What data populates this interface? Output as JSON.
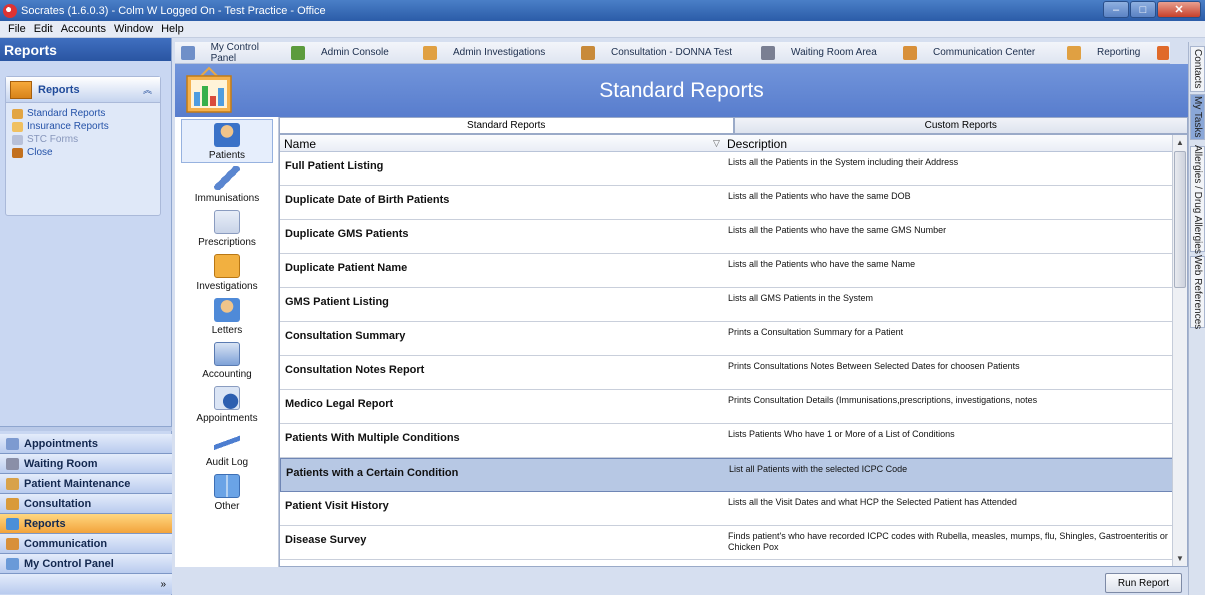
{
  "window": {
    "title": "Socrates (1.6.0.3) - Colm W Logged On - Test Practice - Office"
  },
  "menu": [
    "File",
    "Edit",
    "Accounts",
    "Window",
    "Help"
  ],
  "left_nav": {
    "title": "Reports",
    "task_panel": {
      "title": "Reports",
      "items": [
        {
          "label": "Standard Reports",
          "icon": "standard-reports-icon",
          "enabled": true
        },
        {
          "label": "Insurance Reports",
          "icon": "insurance-reports-icon",
          "enabled": true
        },
        {
          "label": "STC Forms",
          "icon": "stc-forms-icon",
          "enabled": false
        },
        {
          "label": "Close",
          "icon": "close-folder-icon",
          "enabled": true
        }
      ]
    },
    "buttons": [
      {
        "label": "Appointments",
        "icon": "appointments-icon",
        "active": false
      },
      {
        "label": "Waiting Room",
        "icon": "waiting-room-icon",
        "active": false
      },
      {
        "label": "Patient Maintenance",
        "icon": "patient-maintenance-icon",
        "active": false
      },
      {
        "label": "Consultation",
        "icon": "consultation-icon",
        "active": false
      },
      {
        "label": "Reports",
        "icon": "reports-icon",
        "active": true
      },
      {
        "label": "Communication",
        "icon": "communication-icon",
        "active": false
      },
      {
        "label": "My Control Panel",
        "icon": "control-panel-icon",
        "active": false
      }
    ],
    "footer_chevron": "»"
  },
  "shortcuts": [
    {
      "label": "My Control Panel",
      "icon": "control-panel-icon"
    },
    {
      "label": "Admin Console",
      "icon": "admin-console-icon"
    },
    {
      "label": "Admin Investigations",
      "icon": "admin-investigations-icon"
    },
    {
      "label": "Consultation - DONNA Test",
      "icon": "consultation-icon"
    },
    {
      "label": "Waiting Room Area",
      "icon": "waiting-room-icon"
    },
    {
      "label": "Communication Center",
      "icon": "communication-icon"
    },
    {
      "label": "Reporting",
      "icon": "reporting-icon"
    }
  ],
  "right_tabs": [
    "Contacts",
    "My Tasks",
    "Allergies / Drug Allergies",
    "Web References"
  ],
  "main": {
    "title": "Standard Reports",
    "categories": [
      "Patients",
      "Immunisations",
      "Prescriptions",
      "Investigations",
      "Letters",
      "Accounting",
      "Appointments",
      "Audit Log",
      "Other"
    ],
    "tabs": [
      "Standard Reports",
      "Custom Reports"
    ],
    "columns": {
      "name": "Name",
      "description": "Description"
    },
    "rows": [
      {
        "name": "Full Patient Listing",
        "description": "Lists all the Patients in the System including their Address"
      },
      {
        "name": "Duplicate Date of Birth Patients",
        "description": "Lists all the Patients who have the same DOB"
      },
      {
        "name": "Duplicate GMS Patients",
        "description": "Lists all the Patients who have the same GMS Number"
      },
      {
        "name": "Duplicate Patient Name",
        "description": "Lists all the Patients who have the same Name"
      },
      {
        "name": "GMS Patient Listing",
        "description": "Lists all GMS Patients in the System"
      },
      {
        "name": "Consultation Summary",
        "description": "Prints a Consultation Summary for a Patient"
      },
      {
        "name": "Consultation Notes Report",
        "description": "Prints Consultations Notes Between Selected Dates for choosen Patients"
      },
      {
        "name": "Medico Legal Report",
        "description": "Prints Consultation Details (Immunisations,prescriptions, investigations, notes"
      },
      {
        "name": "Patients With Multiple Conditions",
        "description": "Lists Patients Who have 1 or More of a List of Conditions"
      },
      {
        "name": "Patients with a Certain Condition",
        "description": "List all Patients with the selected ICPC Code",
        "selected": true
      },
      {
        "name": "Patient Visit History",
        "description": "Lists all the Visit Dates and what HCP the Selected Patient has Attended"
      },
      {
        "name": "Disease Survey",
        "description": "Finds patient's who have recorded ICPC codes with Rubella, measles, mumps, flu, Shingles, Gastroenteritis or Chicken Pox"
      }
    ],
    "run_button": "Run Report"
  },
  "colors": {
    "header_blue": "#587dcd",
    "nav_active": "#f2a33c",
    "selected_row": "#b7c8e4"
  }
}
